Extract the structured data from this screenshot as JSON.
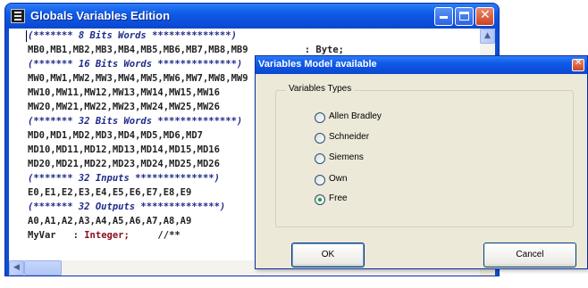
{
  "main_window": {
    "title": "Globals Variables Edition",
    "code_lines": [
      {
        "style": "cm",
        "text": "(******* 8 Bits Words **************)"
      },
      {
        "style": "pl",
        "text": "MB0,MB1,MB2,MB3,MB4,MB5,MB6,MB7,MB8,MB9          : Byte;"
      },
      {
        "style": "cm",
        "text": "(******* 16 Bits Words **************)"
      },
      {
        "style": "pl",
        "text": "MW0,MW1,MW2,MW3,MW4,MW5,MW6,MW7,MW8,MW9"
      },
      {
        "style": "pl",
        "text": "MW10,MW11,MW12,MW13,MW14,MW15,MW16"
      },
      {
        "style": "pl",
        "text": "MW20,MW21,MW22,MW23,MW24,MW25,MW26"
      },
      {
        "style": "cm",
        "text": "(******* 32 Bits Words **************)"
      },
      {
        "style": "pl",
        "text": "MD0,MD1,MD2,MD3,MD4,MD5,MD6,MD7"
      },
      {
        "style": "pl",
        "text": "MD10,MD11,MD12,MD13,MD14,MD15,MD16"
      },
      {
        "style": "pl",
        "text": "MD20,MD21,MD22,MD23,MD24,MD25,MD26"
      },
      {
        "style": "cm",
        "text": "(******* 32 Inputs **************)"
      },
      {
        "style": "pl",
        "text": "E0,E1,E2,E3,E4,E5,E6,E7,E8,E9"
      },
      {
        "style": "cm",
        "text": "(******* 32 Outputs **************)"
      },
      {
        "style": "pl",
        "text": "A0,A1,A2,A3,A4,A5,A6,A7,A8,A9"
      }
    ],
    "last_line": {
      "name": "MyVar",
      "sep": ":",
      "type": "Integer;",
      "comment": "//**"
    }
  },
  "dialog": {
    "title": "Variables Model available",
    "group_label": "Variables Types",
    "options": [
      {
        "label": "Allen Bradley",
        "selected": false
      },
      {
        "label": "Schneider",
        "selected": false
      },
      {
        "label": "Siemens",
        "selected": false
      },
      {
        "label": "Own",
        "selected": false
      },
      {
        "label": "Free",
        "selected": true
      }
    ],
    "ok_label": "OK",
    "cancel_label": "Cancel"
  },
  "icons": {
    "window_icon": "app-icon",
    "minimize": "minimize-icon",
    "maximize": "maximize-icon",
    "close": "close-icon"
  },
  "colors": {
    "titlebar": "#0a4ed6",
    "comment": "#1f2a8a",
    "keyword": "#8a1020",
    "dialog_bg": "#ece9d8"
  }
}
